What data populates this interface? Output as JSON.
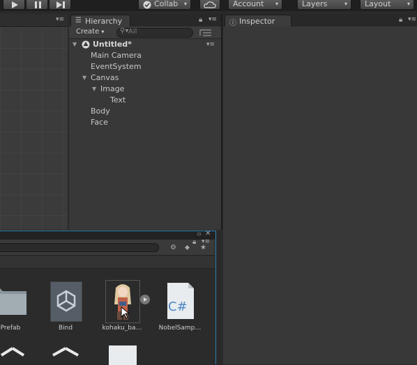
{
  "toolbar": {
    "collab_label": "Collab",
    "account_label": "Account",
    "layers_label": "Layers",
    "layout_label": "Layout",
    "play_icon": "play-icon",
    "pause_icon": "pause-icon",
    "step_icon": "step-icon",
    "cloud_icon": "cloud-icon"
  },
  "hierarchy": {
    "tab_label": "Hierarchy",
    "create_label": "Create",
    "search_placeholder": "All",
    "scene_name": "Untitled*",
    "items": [
      {
        "label": "Main Camera"
      },
      {
        "label": "EventSystem"
      },
      {
        "label": "Canvas"
      },
      {
        "label": "Image"
      },
      {
        "label": "Text"
      },
      {
        "label": "Body"
      },
      {
        "label": "Face"
      }
    ]
  },
  "inspector": {
    "tab_label": "Inspector"
  },
  "project": {
    "assets_row1": [
      {
        "label": "Prefab",
        "type": "folder"
      },
      {
        "label": "Bind",
        "type": "unity-asset"
      },
      {
        "label": "kohaku_ba…",
        "type": "sprite"
      },
      {
        "label": "NobelSamp…",
        "type": "csharp-script",
        "glyph": "C#"
      }
    ]
  },
  "colors": {
    "panel": "#383838",
    "toolbar": "#1f1f1f",
    "focus_border": "#2b7fb8",
    "csharp_blue": "#4f87c6"
  }
}
